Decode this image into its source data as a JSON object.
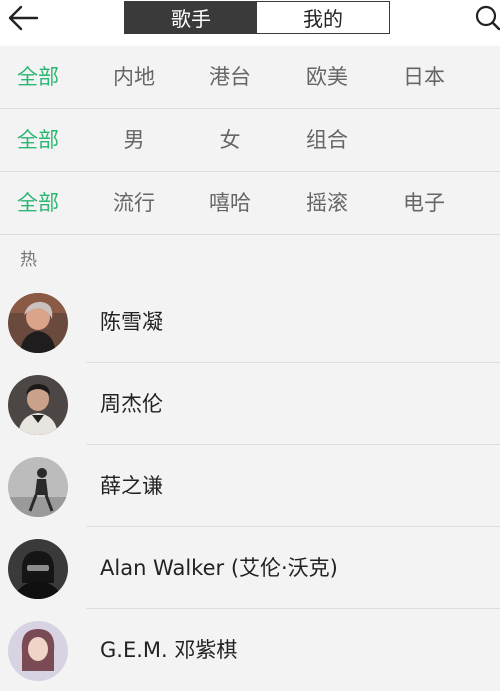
{
  "header": {
    "tabs": [
      "歌手",
      "我的"
    ],
    "active_tab": "歌手",
    "back_icon": "back-arrow-icon",
    "search_icon": "search-icon"
  },
  "filters": {
    "region": [
      "全部",
      "内地",
      "港台",
      "欧美",
      "日本"
    ],
    "gender": [
      "全部",
      "男",
      "女",
      "组合"
    ],
    "genre": [
      "全部",
      "流行",
      "嘻哈",
      "摇滚",
      "电子"
    ]
  },
  "accent_color": "#2bb673",
  "section_title": "热",
  "singers": [
    {
      "name": "陈雪凝"
    },
    {
      "name": "周杰伦"
    },
    {
      "name": "薛之谦"
    },
    {
      "name": "Alan Walker (艾伦·沃克)"
    },
    {
      "name": "G.E.M. 邓紫棋"
    }
  ]
}
